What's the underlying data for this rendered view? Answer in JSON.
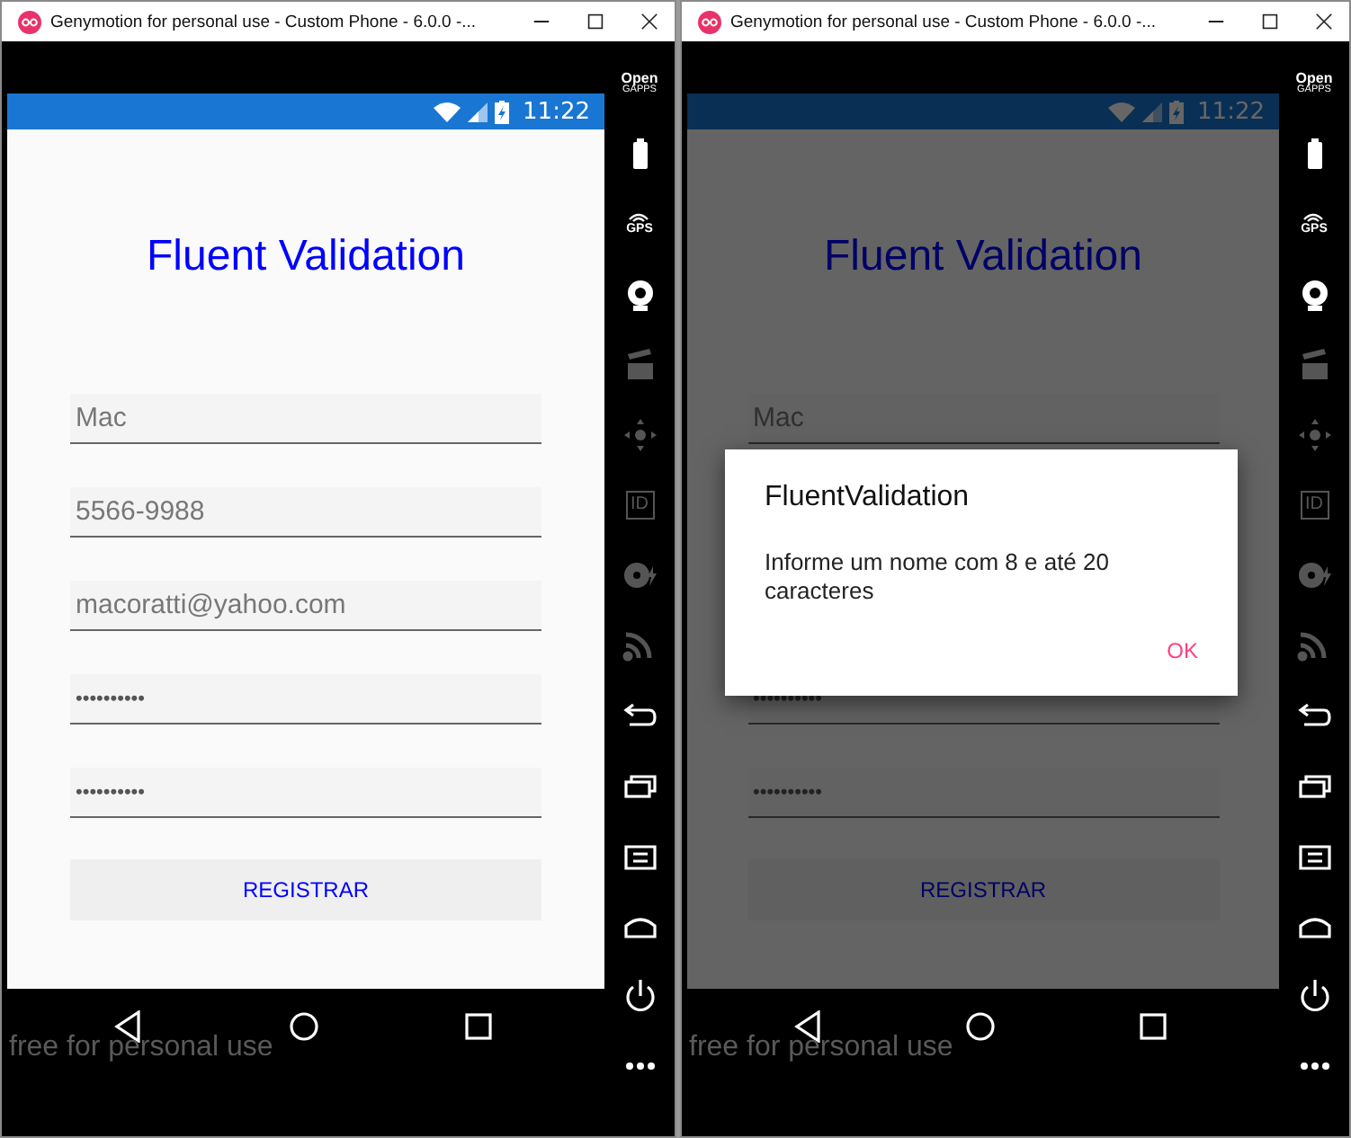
{
  "windows": [
    {
      "title": "Genymotion for personal use - Custom Phone - 6.0.0 -...",
      "status_time": "11:22",
      "tools": [
        {
          "kind": "gapps",
          "top": "Open",
          "bottom": "GAPPS",
          "disabled": false
        },
        {
          "kind": "battery",
          "disabled": false
        },
        {
          "kind": "gps",
          "label": "GPS",
          "disabled": false
        },
        {
          "kind": "camera",
          "disabled": false
        },
        {
          "kind": "media",
          "disabled": true
        },
        {
          "kind": "dpad",
          "disabled": true
        },
        {
          "kind": "id",
          "label": "ID",
          "disabled": true
        },
        {
          "kind": "disk",
          "disabled": true
        },
        {
          "kind": "cast",
          "disabled": true
        },
        {
          "kind": "back",
          "disabled": false
        },
        {
          "kind": "recent",
          "disabled": false
        },
        {
          "kind": "menu",
          "disabled": false
        },
        {
          "kind": "home",
          "disabled": false
        },
        {
          "kind": "power",
          "disabled": false
        },
        {
          "kind": "more",
          "disabled": false
        }
      ],
      "app": {
        "heading": "Fluent Validation",
        "fields": [
          {
            "kind": "text",
            "value": "Mac"
          },
          {
            "kind": "text",
            "value": "5566-9988"
          },
          {
            "kind": "text",
            "value": "macoratti@yahoo.com"
          },
          {
            "kind": "password",
            "value": "••••••••••"
          },
          {
            "kind": "password",
            "value": "••••••••••"
          }
        ],
        "button": "REGISTRAR"
      },
      "overlay_text": "free for personal use"
    },
    {
      "title": "Genymotion for personal use - Custom Phone - 6.0.0 -...",
      "status_time": "11:22",
      "tools": [
        {
          "kind": "gapps",
          "top": "Open",
          "bottom": "GAPPS",
          "disabled": false
        },
        {
          "kind": "battery",
          "disabled": false
        },
        {
          "kind": "gps",
          "label": "GPS",
          "disabled": false
        },
        {
          "kind": "camera",
          "disabled": false
        },
        {
          "kind": "media",
          "disabled": true
        },
        {
          "kind": "dpad",
          "disabled": true
        },
        {
          "kind": "id",
          "label": "ID",
          "disabled": true
        },
        {
          "kind": "disk",
          "disabled": true
        },
        {
          "kind": "cast",
          "disabled": true
        },
        {
          "kind": "back",
          "disabled": false
        },
        {
          "kind": "recent",
          "disabled": false
        },
        {
          "kind": "menu",
          "disabled": false
        },
        {
          "kind": "home",
          "disabled": false
        },
        {
          "kind": "power",
          "disabled": false
        },
        {
          "kind": "more",
          "disabled": false
        }
      ],
      "app": {
        "heading": "Fluent Validation",
        "fields": [
          {
            "kind": "text",
            "value": "Mac"
          },
          {
            "kind": "covered"
          },
          {
            "kind": "covered"
          },
          {
            "kind": "password",
            "value": "••••••••••"
          },
          {
            "kind": "password",
            "value": "••••••••••"
          }
        ],
        "button": "REGISTRAR"
      },
      "dialog": {
        "title": "FluentValidation",
        "message": "Informe um nome com 8 e até 20 caracteres",
        "button": "OK"
      },
      "overlay_text": "free for personal use"
    }
  ]
}
